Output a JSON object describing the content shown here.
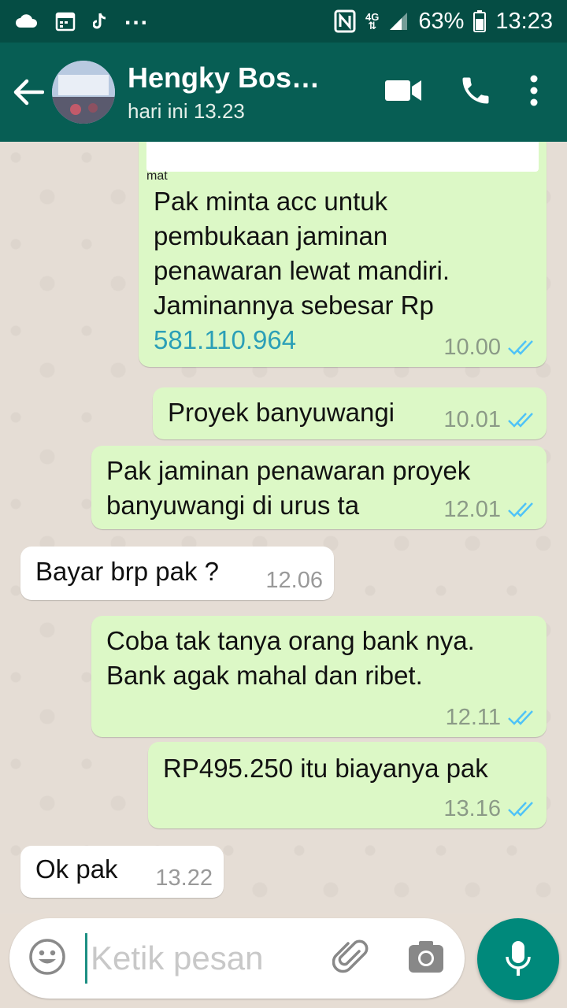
{
  "status_bar": {
    "more": "...",
    "network": "4G",
    "battery": "63%",
    "time": "13:23"
  },
  "header": {
    "contact_name": "Hengky Bos…",
    "last_seen": "hari ini 13.23"
  },
  "messages": [
    {
      "dir": "out",
      "caption": "mat",
      "text": "Pak minta acc untuk\npembukaan jaminan\npenawaran lewat mandiri.\nJaminannya sebesar Rp",
      "link": "581.110.964",
      "time": "10.00",
      "status": "read"
    },
    {
      "dir": "out",
      "text": "Proyek banyuwangi",
      "time": "10.01",
      "status": "read"
    },
    {
      "dir": "out",
      "text": "Pak jaminan penawaran proyek\nbanyuwangi di urus ta",
      "time": "12.01",
      "status": "read"
    },
    {
      "dir": "in",
      "text": "Bayar brp pak ?",
      "time": "12.06"
    },
    {
      "dir": "out",
      "text": "Coba tak tanya orang bank nya.\nBank agak mahal dan ribet.",
      "time": "12.11",
      "status": "read"
    },
    {
      "dir": "out",
      "text": "RP495.250  itu biayanya pak",
      "time": "13.16",
      "status": "read"
    },
    {
      "dir": "in",
      "text": "Ok pak",
      "time": "13.22"
    }
  ],
  "input": {
    "placeholder": "Ketik pesan"
  },
  "colors": {
    "header": "#075e54",
    "status_bar": "#054d44",
    "outgoing_bubble": "#dcf8c6",
    "incoming_bubble": "#ffffff",
    "read_ticks": "#4fc3f7",
    "fab": "#00897b"
  },
  "icons": {
    "status_left": [
      "cloud-icon",
      "calendar-icon",
      "tiktok-icon"
    ],
    "status_right": [
      "nfc-icon",
      "signal-icon",
      "battery-icon"
    ],
    "header": [
      "back-arrow-icon",
      "video-call-icon",
      "phone-icon",
      "more-vert-icon"
    ],
    "input": [
      "emoji-icon",
      "attachment-icon",
      "camera-icon",
      "mic-icon"
    ]
  }
}
